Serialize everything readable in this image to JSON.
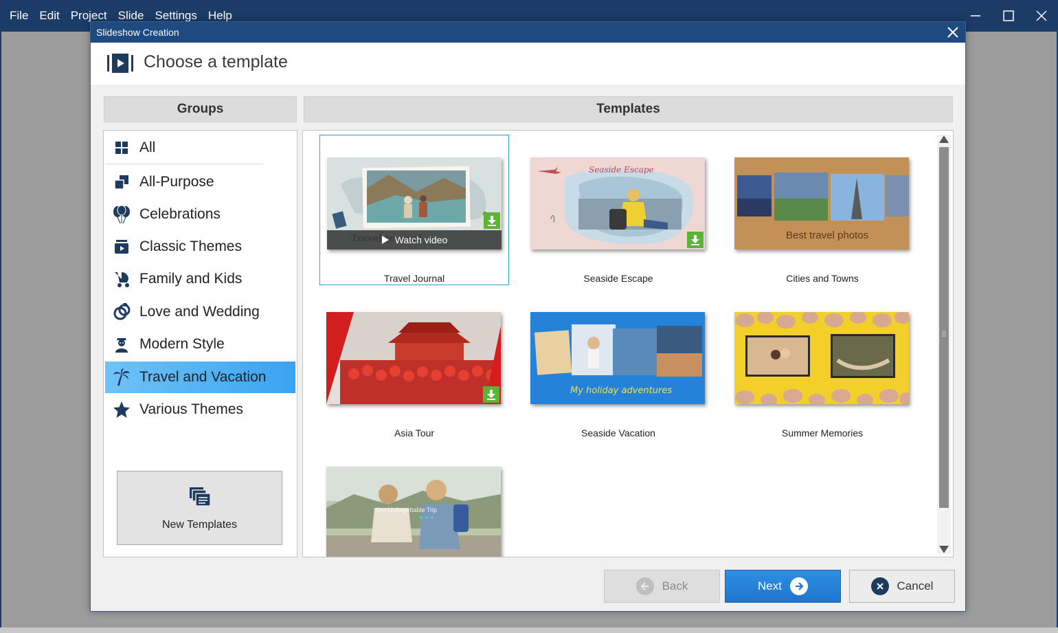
{
  "app": {
    "menu": [
      "File",
      "Edit",
      "Project",
      "Slide",
      "Settings",
      "Help"
    ]
  },
  "dialog": {
    "title": "Slideshow Creation",
    "header": "Choose a template"
  },
  "groups": {
    "heading": "Groups",
    "items": [
      {
        "label": "All",
        "icon": "grid-icon"
      },
      {
        "label": "All-Purpose",
        "icon": "stacked-squares-icon"
      },
      {
        "label": "Celebrations",
        "icon": "balloons-icon"
      },
      {
        "label": "Classic Themes",
        "icon": "film-box-icon"
      },
      {
        "label": "Family and Kids",
        "icon": "stroller-icon"
      },
      {
        "label": "Love and Wedding",
        "icon": "rings-icon"
      },
      {
        "label": "Modern Style",
        "icon": "person-icon"
      },
      {
        "label": "Travel and Vacation",
        "icon": "palm-tree-icon"
      },
      {
        "label": "Various Themes",
        "icon": "star-icon"
      }
    ],
    "selected": "Travel and Vacation",
    "new_templates_label": "New Templates"
  },
  "templates": {
    "heading": "Templates",
    "watch_video_label": "Watch video",
    "items": [
      {
        "name": "Travel Journal",
        "caption": "Travel Journal",
        "downloadable": true,
        "selected": true
      },
      {
        "name": "Seaside Escape",
        "caption": "Seaside Escape",
        "downloadable": true
      },
      {
        "name": "Cities and Towns",
        "caption": "Best travel photos",
        "downloadable": false
      },
      {
        "name": "Asia Tour",
        "downloadable": true
      },
      {
        "name": "Seaside Vacation",
        "caption": "My holiday adventures",
        "downloadable": false
      },
      {
        "name": "Summer Memories",
        "downloadable": false
      },
      {
        "name": "",
        "caption": "Our Unforgettable Trip",
        "downloadable": false
      }
    ]
  },
  "buttons": {
    "back": "Back",
    "next": "Next",
    "cancel": "Cancel"
  },
  "colors": {
    "titlebar": "#1e4a80",
    "selection": "#3aa3f0",
    "next_button": "#2381d8",
    "download_badge": "#5bb534"
  }
}
